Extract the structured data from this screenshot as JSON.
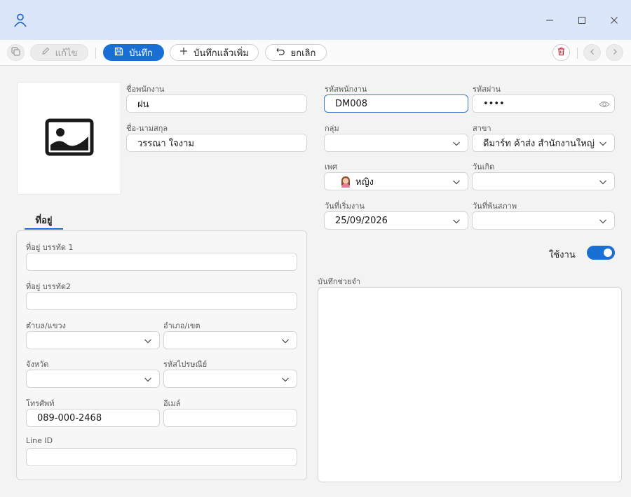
{
  "toolbar": {
    "edit_label": "แก้ไข",
    "save_label": "บันทึก",
    "save_new_label": "บันทึกแล้วเพิ่ม",
    "cancel_label": "ยกเลิก"
  },
  "form": {
    "nickname": {
      "label": "ชื่อพนักงาน",
      "value": "ฝน"
    },
    "fullname": {
      "label": "ชื่อ-นามสกุล",
      "value": "วรรณา ใจงาม"
    },
    "employee_code": {
      "label": "รหัสพนักงาน",
      "value": "DM008"
    },
    "password": {
      "label": "รหัสผ่าน",
      "value": "••••"
    },
    "group": {
      "label": "กลุ่ม",
      "value": ""
    },
    "branch": {
      "label": "สาขา",
      "value": "ดีมาร์ท ค้าส่ง สำนักงานใหญ่"
    },
    "gender": {
      "label": "เพศ",
      "value": "หญิง"
    },
    "birthdate": {
      "label": "วันเกิด",
      "value": ""
    },
    "start_date": {
      "label": "วันที่เริ่มงาน",
      "value": "25/09/2026"
    },
    "end_date": {
      "label": "วันที่พ้นสภาพ",
      "value": ""
    },
    "active": {
      "label": "ใช้งาน",
      "on": true
    },
    "notes": {
      "label": "บันทึกช่วยจำ",
      "value": ""
    }
  },
  "address": {
    "tab_label": "ที่อยู่",
    "line1": {
      "label": "ที่อยู่ บรรทัด 1",
      "value": ""
    },
    "line2": {
      "label": "ที่อยู่ บรรทัด2",
      "value": ""
    },
    "subdistrict": {
      "label": "ตำบล/แขวง",
      "value": ""
    },
    "district": {
      "label": "อำเภอ/เขต",
      "value": ""
    },
    "province": {
      "label": "จังหวัด",
      "value": ""
    },
    "postcode": {
      "label": "รหัสไปรษณีย์",
      "value": ""
    },
    "phone": {
      "label": "โทรศัพท์",
      "value": "089-000-2468"
    },
    "email": {
      "label": "อีเมล์",
      "value": ""
    },
    "line_id": {
      "label": "Line ID",
      "value": ""
    }
  },
  "colors": {
    "accent": "#1a6fd4",
    "titlebar": "#dbe6fb",
    "delete": "#d0263a"
  }
}
